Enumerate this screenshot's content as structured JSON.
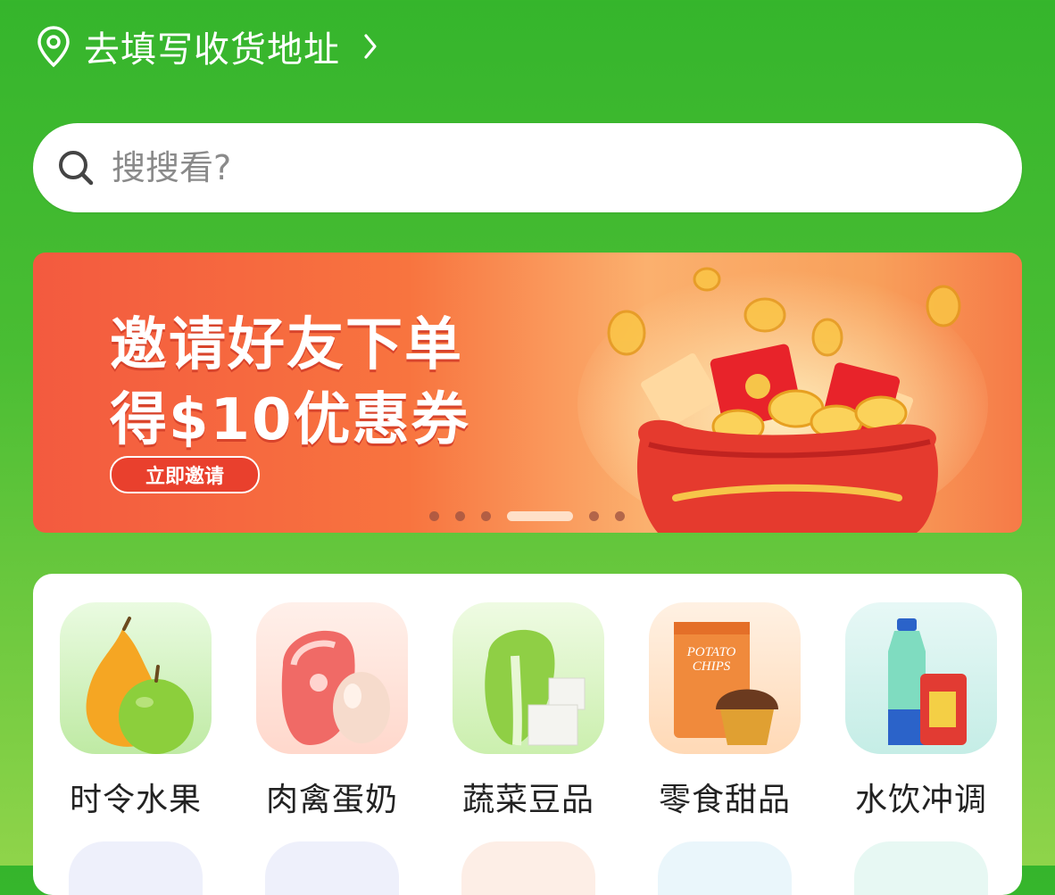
{
  "address": {
    "label": "去填写收货地址"
  },
  "search": {
    "placeholder": "搜搜看?"
  },
  "banner": {
    "line1": "邀请好友下单",
    "line2": "得$10优惠券",
    "cta": "立即邀请",
    "slides_total": 6,
    "active_slide": 4
  },
  "categories": [
    {
      "label": "时令水果",
      "icon": "fruit-icon"
    },
    {
      "label": "肉禽蛋奶",
      "icon": "meat-egg-icon"
    },
    {
      "label": "蔬菜豆品",
      "icon": "vegetable-tofu-icon"
    },
    {
      "label": "零食甜品",
      "icon": "snack-dessert-icon"
    },
    {
      "label": "水饮冲调",
      "icon": "drink-icon"
    }
  ],
  "colors": {
    "brand_green": "#35b52c",
    "banner_red": "#f35a3f",
    "white": "#ffffff"
  }
}
